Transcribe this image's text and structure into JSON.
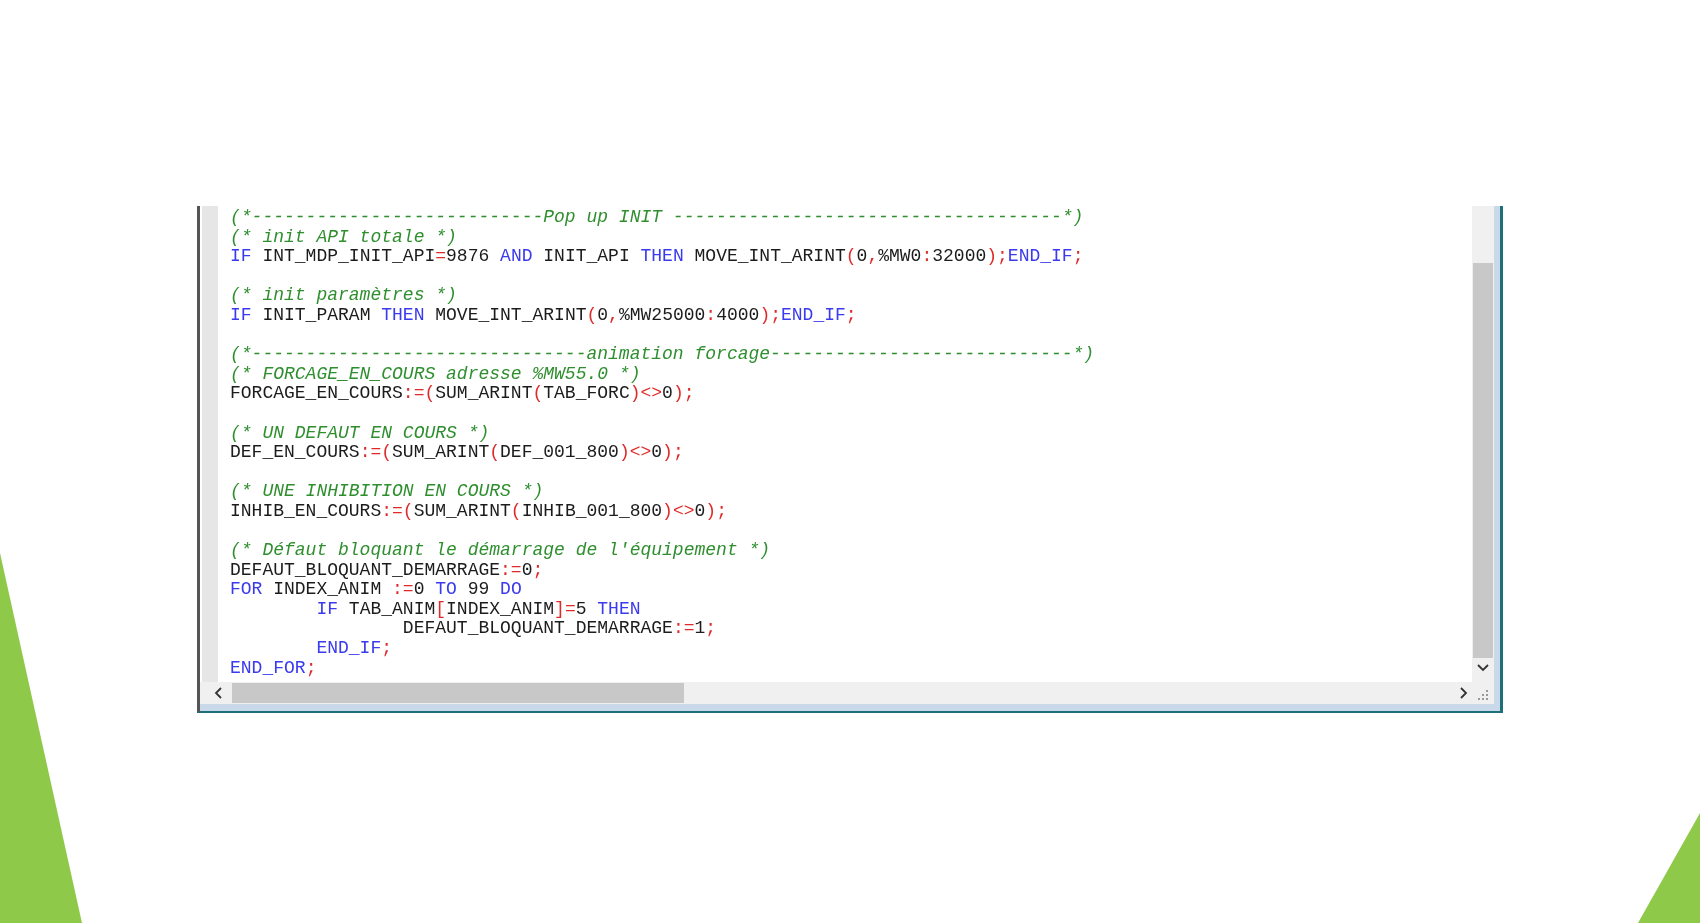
{
  "editor": {
    "lines": [
      {
        "kind": "code",
        "tokens": [
          {
            "kind": "comment",
            "text": "(*---------------------------Pop up INIT ------------------------------------*)"
          }
        ]
      },
      {
        "kind": "code",
        "tokens": [
          {
            "kind": "comment",
            "text": "(* init API totale *)"
          }
        ]
      },
      {
        "kind": "code",
        "tokens": [
          {
            "kind": "keyword",
            "text": "IF"
          },
          {
            "kind": "ident",
            "text": " INT_MDP_INIT_API"
          },
          {
            "kind": "op",
            "text": "="
          },
          {
            "kind": "ident",
            "text": "9876 "
          },
          {
            "kind": "keyword",
            "text": "AND"
          },
          {
            "kind": "ident",
            "text": " INIT_API "
          },
          {
            "kind": "keyword",
            "text": "THEN"
          },
          {
            "kind": "ident",
            "text": " MOVE_INT_ARINT"
          },
          {
            "kind": "op",
            "text": "("
          },
          {
            "kind": "ident",
            "text": "0"
          },
          {
            "kind": "op",
            "text": ","
          },
          {
            "kind": "ident",
            "text": "%MW0"
          },
          {
            "kind": "op",
            "text": ":"
          },
          {
            "kind": "ident",
            "text": "32000"
          },
          {
            "kind": "op",
            "text": ");"
          },
          {
            "kind": "keyword",
            "text": "END_IF"
          },
          {
            "kind": "op",
            "text": ";"
          }
        ]
      },
      {
        "kind": "blank"
      },
      {
        "kind": "code",
        "tokens": [
          {
            "kind": "comment",
            "text": "(* init paramètres *)"
          }
        ]
      },
      {
        "kind": "code",
        "tokens": [
          {
            "kind": "keyword",
            "text": "IF"
          },
          {
            "kind": "ident",
            "text": " INIT_PARAM "
          },
          {
            "kind": "keyword",
            "text": "THEN"
          },
          {
            "kind": "ident",
            "text": " MOVE_INT_ARINT"
          },
          {
            "kind": "op",
            "text": "("
          },
          {
            "kind": "ident",
            "text": "0"
          },
          {
            "kind": "op",
            "text": ","
          },
          {
            "kind": "ident",
            "text": "%MW25000"
          },
          {
            "kind": "op",
            "text": ":"
          },
          {
            "kind": "ident",
            "text": "4000"
          },
          {
            "kind": "op",
            "text": ");"
          },
          {
            "kind": "keyword",
            "text": "END_IF"
          },
          {
            "kind": "op",
            "text": ";"
          }
        ]
      },
      {
        "kind": "blank"
      },
      {
        "kind": "code",
        "tokens": [
          {
            "kind": "comment",
            "text": "(*-------------------------------animation forcage----------------------------*)"
          }
        ]
      },
      {
        "kind": "code",
        "tokens": [
          {
            "kind": "comment",
            "text": "(* FORCAGE_EN_COURS adresse %MW55.0 *)"
          }
        ]
      },
      {
        "kind": "code",
        "tokens": [
          {
            "kind": "ident",
            "text": "FORCAGE_EN_COURS"
          },
          {
            "kind": "op",
            "text": ":=("
          },
          {
            "kind": "ident",
            "text": "SUM_ARINT"
          },
          {
            "kind": "op",
            "text": "("
          },
          {
            "kind": "ident",
            "text": "TAB_FORC"
          },
          {
            "kind": "op",
            "text": ")<>"
          },
          {
            "kind": "ident",
            "text": "0"
          },
          {
            "kind": "op",
            "text": ");"
          }
        ]
      },
      {
        "kind": "blank"
      },
      {
        "kind": "code",
        "tokens": [
          {
            "kind": "comment",
            "text": "(* UN DEFAUT EN COURS *)"
          }
        ]
      },
      {
        "kind": "code",
        "tokens": [
          {
            "kind": "ident",
            "text": "DEF_EN_COURS"
          },
          {
            "kind": "op",
            "text": ":=("
          },
          {
            "kind": "ident",
            "text": "SUM_ARINT"
          },
          {
            "kind": "op",
            "text": "("
          },
          {
            "kind": "ident",
            "text": "DEF_001_800"
          },
          {
            "kind": "op",
            "text": ")<>"
          },
          {
            "kind": "ident",
            "text": "0"
          },
          {
            "kind": "op",
            "text": ");"
          }
        ]
      },
      {
        "kind": "blank"
      },
      {
        "kind": "code",
        "tokens": [
          {
            "kind": "comment",
            "text": "(* UNE INHIBITION EN COURS *)"
          }
        ]
      },
      {
        "kind": "code",
        "tokens": [
          {
            "kind": "ident",
            "text": "INHIB_EN_COURS"
          },
          {
            "kind": "op",
            "text": ":=("
          },
          {
            "kind": "ident",
            "text": "SUM_ARINT"
          },
          {
            "kind": "op",
            "text": "("
          },
          {
            "kind": "ident",
            "text": "INHIB_001_800"
          },
          {
            "kind": "op",
            "text": ")<>"
          },
          {
            "kind": "ident",
            "text": "0"
          },
          {
            "kind": "op",
            "text": ");"
          }
        ]
      },
      {
        "kind": "blank"
      },
      {
        "kind": "code",
        "tokens": [
          {
            "kind": "comment",
            "text": "(* Défaut bloquant le démarrage de l'équipement *)"
          }
        ]
      },
      {
        "kind": "code",
        "tokens": [
          {
            "kind": "ident",
            "text": "DEFAUT_BLOQUANT_DEMARRAGE"
          },
          {
            "kind": "op",
            "text": ":="
          },
          {
            "kind": "ident",
            "text": "0"
          },
          {
            "kind": "op",
            "text": ";"
          }
        ]
      },
      {
        "kind": "code",
        "tokens": [
          {
            "kind": "keyword",
            "text": "FOR"
          },
          {
            "kind": "ident",
            "text": " INDEX_ANIM "
          },
          {
            "kind": "op",
            "text": ":="
          },
          {
            "kind": "ident",
            "text": "0 "
          },
          {
            "kind": "keyword",
            "text": "TO"
          },
          {
            "kind": "ident",
            "text": " 99 "
          },
          {
            "kind": "keyword",
            "text": "DO"
          }
        ]
      },
      {
        "kind": "code",
        "tokens": [
          {
            "kind": "keyword",
            "text": "        IF"
          },
          {
            "kind": "ident",
            "text": " TAB_ANIM"
          },
          {
            "kind": "op",
            "text": "["
          },
          {
            "kind": "ident",
            "text": "INDEX_ANIM"
          },
          {
            "kind": "op",
            "text": "]="
          },
          {
            "kind": "ident",
            "text": "5 "
          },
          {
            "kind": "keyword",
            "text": "THEN"
          }
        ]
      },
      {
        "kind": "code",
        "tokens": [
          {
            "kind": "ident",
            "text": "                DEFAUT_BLOQUANT_DEMARRAGE"
          },
          {
            "kind": "op",
            "text": ":="
          },
          {
            "kind": "ident",
            "text": "1"
          },
          {
            "kind": "op",
            "text": ";"
          }
        ]
      },
      {
        "kind": "code",
        "tokens": [
          {
            "kind": "keyword",
            "text": "        END_IF"
          },
          {
            "kind": "op",
            "text": ";"
          }
        ]
      },
      {
        "kind": "code",
        "tokens": [
          {
            "kind": "keyword",
            "text": "END_FOR"
          },
          {
            "kind": "op",
            "text": ";"
          }
        ]
      }
    ]
  }
}
